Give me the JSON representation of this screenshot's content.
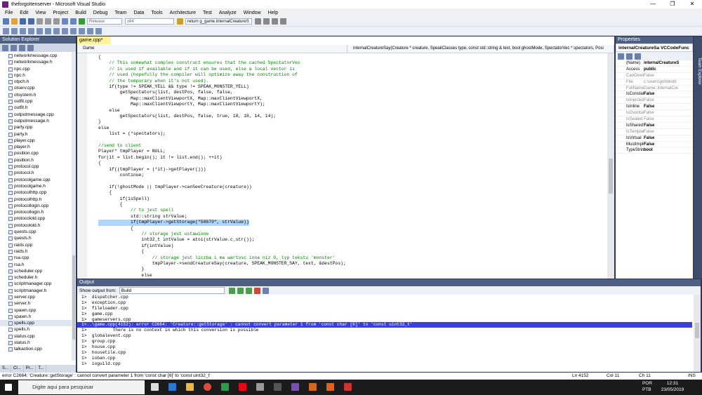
{
  "window": {
    "title": "theforgottenserver - Microsoft Visual Studio",
    "controls": [
      "—",
      "❐",
      "✕"
    ]
  },
  "menu": [
    "File",
    "Edit",
    "View",
    "Project",
    "Build",
    "Debug",
    "Team",
    "Data",
    "Tools",
    "Architecture",
    "Test",
    "Analyze",
    "Window",
    "Help"
  ],
  "toolbar": {
    "config": "Release",
    "platform": "x64",
    "find": "return g_game.internalCreatureS"
  },
  "solution_explorer": {
    "title": "Solution Explorer",
    "files": [
      "networkmessage.cpp",
      "networkmessage.h",
      "npc.cpp",
      "npc.h",
      "otpch.h",
      "otserv.cpp",
      "otsystem.h",
      "outfit.cpp",
      "outfit.h",
      "outputmessage.cpp",
      "outputmessage.h",
      "party.cpp",
      "party.h",
      "player.cpp",
      "player.h",
      "position.cpp",
      "position.h",
      "protocol.cpp",
      "protocol.h",
      "protocolgame.cpp",
      "protocolgame.h",
      "protocolhttp.cpp",
      "protocolhttp.h",
      "protocollogin.cpp",
      "protocollogin.h",
      "protocolold.cpp",
      "protocolold.h",
      "quests.cpp",
      "quests.h",
      "raids.cpp",
      "raids.h",
      "rsa.cpp",
      "rsa.h",
      "scheduler.cpp",
      "scheduler.h",
      "scriptmanager.cpp",
      "scriptmanager.h",
      "server.cpp",
      "server.h",
      "spawn.cpp",
      "spawn.h",
      "spells.cpp",
      "spells.h",
      "status.cpp",
      "status.h",
      "talkaction.cpp"
    ],
    "selected": "spells.cpp",
    "tabs": [
      "S...",
      "Cl...",
      "Pr...",
      "T..."
    ]
  },
  "editor": {
    "tab": "game.cpp*",
    "nav_scope": "Game",
    "nav_member": "internalCreatureSay(Creature * creature, SpeakClasses type, const std::string & text, bool ghostMode, SpectatorVec * spectators, Posi",
    "lines": [
      {
        "t": "{",
        "c": ""
      },
      {
        "t": "    // This somewhat complex construct ensures that the cached SpectatorVec",
        "c": "cm"
      },
      {
        "t": "    // is used if available and if it can be used, else a local vector is",
        "c": "cm"
      },
      {
        "t": "    // used (hopefully the compiler will optimize away the construction of",
        "c": "cm"
      },
      {
        "t": "    // the temporary when it's not used).",
        "c": "cm"
      },
      {
        "t": "    if(type != SPEAK_YELL && type != SPEAK_MONSTER_YELL)",
        "c": ""
      },
      {
        "t": "        getSpectators(list, destPos, false, false,",
        "c": ""
      },
      {
        "t": "            Map::maxClientViewportX, Map::maxClientViewportX,",
        "c": ""
      },
      {
        "t": "            Map::maxClientViewportY, Map::maxClientViewportY);",
        "c": ""
      },
      {
        "t": "    else",
        "c": ""
      },
      {
        "t": "        getSpectators(list, destPos, false, true, 18, 18, 14, 14);",
        "c": ""
      },
      {
        "t": "}",
        "c": ""
      },
      {
        "t": "else",
        "c": ""
      },
      {
        "t": "    list = (*spectators);",
        "c": ""
      },
      {
        "t": "",
        "c": ""
      },
      {
        "t": "//send to client",
        "c": "cm"
      },
      {
        "t": "Player* tmpPlayer = NULL;",
        "c": ""
      },
      {
        "t": "for(it = list.begin(); it != list.end(); ++it)",
        "c": ""
      },
      {
        "t": "{",
        "c": ""
      },
      {
        "t": "    if((tmpPlayer = (*it)->getPlayer()))",
        "c": ""
      },
      {
        "t": "        continue;",
        "c": ""
      },
      {
        "t": "",
        "c": ""
      },
      {
        "t": "    if(!ghostMode || tmpPlayer->canSeeCreature(creature))",
        "c": ""
      },
      {
        "t": "    {",
        "c": ""
      },
      {
        "t": "        if(isSpell)",
        "c": ""
      },
      {
        "t": "        {",
        "c": ""
      },
      {
        "t": "            // to jest spell",
        "c": "cm"
      },
      {
        "t": "            std::string strValue;",
        "c": ""
      },
      {
        "t": "            if(tmpPlayer->getStorage(\"58670\", strValue))",
        "c": "hl"
      },
      {
        "t": "            {",
        "c": ""
      },
      {
        "t": "                // storage jest ustawione",
        "c": "cm"
      },
      {
        "t": "                int32_t intValue = atoi(strValue.c_str());",
        "c": ""
      },
      {
        "t": "                if(intValue)",
        "c": ""
      },
      {
        "t": "                {",
        "c": ""
      },
      {
        "t": "                    // storage jest liczba i ma wartosc inna niz 0, typ tekstu 'monster'",
        "c": "cm"
      },
      {
        "t": "                    tmpPlayer->sendCreatureSay(creature, SPEAK_MONSTER_SAY, text, &destPos);",
        "c": ""
      },
      {
        "t": "                }",
        "c": ""
      },
      {
        "t": "                else",
        "c": ""
      },
      {
        "t": "                {",
        "c": ""
      }
    ]
  },
  "output": {
    "title": "Output",
    "show_from_label": "Show output from:",
    "show_from_value": "Build",
    "lines": [
      {
        "t": "1>  dispatcher.cpp",
        "err": false
      },
      {
        "t": "1>  exception.cpp",
        "err": false
      },
      {
        "t": "1>  fileloader.cpp",
        "err": false
      },
      {
        "t": "1>  game.cpp",
        "err": false
      },
      {
        "t": "1>  gameservers.cpp",
        "err": false
      },
      {
        "t": "1>..\\game.cpp(4152): error C2664: 'Creature::getStorage' : cannot convert parameter 1 from 'const char [6]' to 'const uint32_t'",
        "err": true
      },
      {
        "t": "1>          There is no context in which this conversion is possible",
        "err": false
      },
      {
        "t": "1>  globalevent.cpp",
        "err": false
      },
      {
        "t": "1>  group.cpp",
        "err": false
      },
      {
        "t": "1>  house.cpp",
        "err": false
      },
      {
        "t": "1>  housetile.cpp",
        "err": false
      },
      {
        "t": "1>  ioban.cpp",
        "err": false
      },
      {
        "t": "1>  ioguild.cpp",
        "err": false
      }
    ]
  },
  "properties": {
    "title": "Properties",
    "object": "internalCreatureSa VCCodeFunc",
    "rows": [
      {
        "k": "(Name)",
        "v": "internalCreatureS",
        "dim": false
      },
      {
        "k": "Access",
        "v": "public",
        "dim": false
      },
      {
        "k": "CanOverride",
        "v": "False",
        "dim": true
      },
      {
        "k": "File",
        "v": "c:\\users\\gol\\deskt",
        "dim": true
      },
      {
        "k": "FullName",
        "v": "Game::internalCre",
        "dim": true
      },
      {
        "k": "IsConstant",
        "v": "False",
        "dim": false
      },
      {
        "k": "IsInjected",
        "v": "False",
        "dim": true
      },
      {
        "k": "IsInline",
        "v": "False",
        "dim": false
      },
      {
        "k": "IsOverloaded",
        "v": "False",
        "dim": true
      },
      {
        "k": "IsSealed",
        "v": "False",
        "dim": true
      },
      {
        "k": "IsShared",
        "v": "False",
        "dim": false
      },
      {
        "k": "IsTemplate",
        "v": "False",
        "dim": true
      },
      {
        "k": "IsVirtual",
        "v": "False",
        "dim": false
      },
      {
        "k": "MustImpleme",
        "v": "False",
        "dim": false
      },
      {
        "k": "TypeString",
        "v": "bool",
        "dim": false
      }
    ],
    "side_label": "Team Explorer"
  },
  "status": {
    "message": "error C2664: 'Creature::getStorage' : cannot convert parameter 1 from 'const char [6]' to 'const uint32_t'",
    "ln": "Ln 4152",
    "col": "Col 11",
    "ch": "Ch 11",
    "mode": "INS"
  },
  "taskbar": {
    "search_placeholder": "Digite aqui para pesquisar",
    "lang1": "POR",
    "lang2": "PTB",
    "time": "12:31",
    "date": "23/05/2019"
  },
  "colors": {
    "accent": "#293955",
    "selection": "#add6ff",
    "error_line": "#3a3fd8"
  }
}
